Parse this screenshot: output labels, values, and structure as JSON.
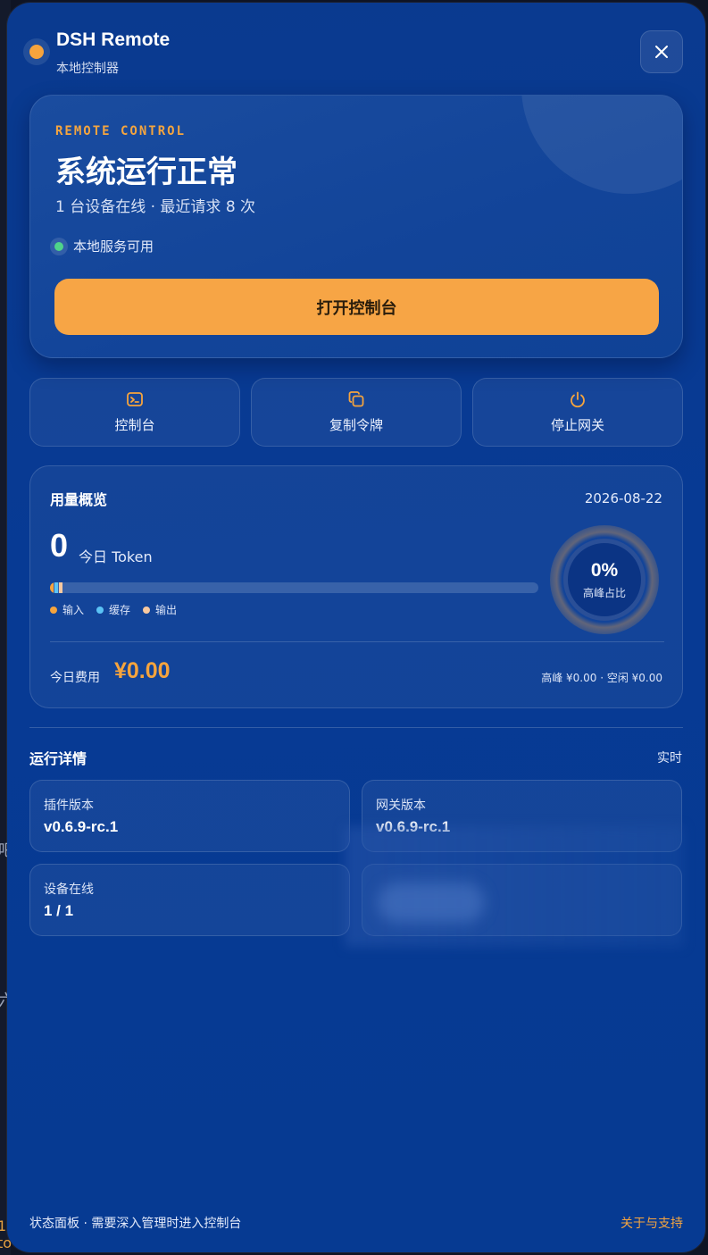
{
  "app": {
    "title": "DSH Remote",
    "subtitle": "本地控制器"
  },
  "hero": {
    "eyebrow": "REMOTE CONTROL",
    "title": "系统运行正常",
    "subtitle": "1 台设备在线 · 最近请求 8 次",
    "status": "本地服务可用",
    "status_color": "#4fd38a",
    "primary_button": "打开控制台"
  },
  "actions": [
    {
      "label": "控制台",
      "icon": "terminal-icon"
    },
    {
      "label": "复制令牌",
      "icon": "copy-icon"
    },
    {
      "label": "停止网关",
      "icon": "power-icon"
    }
  ],
  "usage": {
    "title": "用量概览",
    "date": "2026-08-22",
    "token_value": "0",
    "token_label": "今日 Token",
    "legend": [
      {
        "label": "输入",
        "color": "#f6a43d"
      },
      {
        "label": "缓存",
        "color": "#5bc3f5"
      },
      {
        "label": "输出",
        "color": "#f8c9a0"
      }
    ],
    "peak_pct": "0%",
    "peak_label": "高峰占比",
    "cost_label": "今日费用",
    "cost_value": "¥0.00",
    "cost_breakdown": "高峰 ¥0.00 · 空闲 ¥0.00"
  },
  "details": {
    "title": "运行详情",
    "realtime": "实时",
    "cards": [
      {
        "key": "插件版本",
        "value": "v0.6.9-rc.1"
      },
      {
        "key": "网关版本",
        "value": "v0.6.9-rc.1"
      },
      {
        "key": "设备在线",
        "value": "1 / 1"
      }
    ]
  },
  "footer": {
    "left": "状态面板 · 需要深入管理时进入控制台",
    "right": "关于与支持"
  },
  "colors": {
    "accent": "#f6a43d",
    "panel_bg": "#073a94"
  }
}
